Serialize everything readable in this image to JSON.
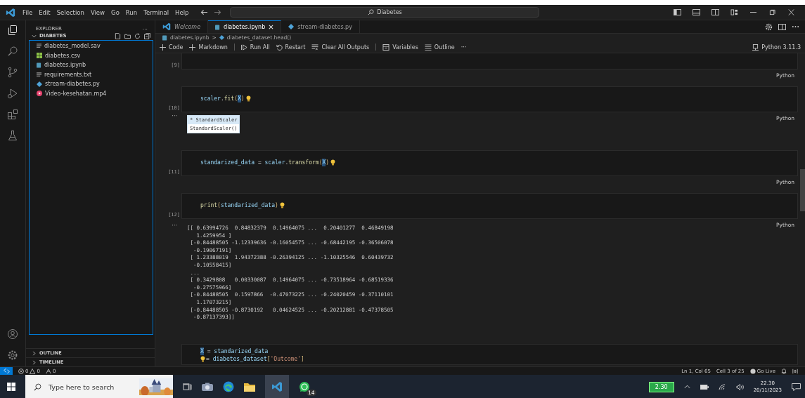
{
  "menu": [
    "File",
    "Edit",
    "Selection",
    "View",
    "Go",
    "Run",
    "Terminal",
    "Help"
  ],
  "command_center": {
    "value": "Diabetes"
  },
  "explorer": {
    "title": "EXPLORER",
    "more": "···",
    "folder": "DIABETES",
    "expanded": true,
    "files": [
      {
        "name": "diabetes_model.sav",
        "kind": "text"
      },
      {
        "name": "diabetes.csv",
        "kind": "csv"
      },
      {
        "name": "diabetes.ipynb",
        "kind": "notebook"
      },
      {
        "name": "requirements.txt",
        "kind": "text"
      },
      {
        "name": "stream-diabetes.py",
        "kind": "python"
      },
      {
        "name": "Video-kesehatan.mp4",
        "kind": "video"
      }
    ],
    "sections": [
      {
        "label": "OUTLINE",
        "expanded": false
      },
      {
        "label": "TIMELINE",
        "expanded": false
      }
    ]
  },
  "tabs": [
    {
      "label": "Welcome",
      "kind": "welcome",
      "selected": false
    },
    {
      "label": "diabetes.ipynb",
      "kind": "notebook",
      "selected": true
    },
    {
      "label": "stream-diabetes.py",
      "kind": "python",
      "selected": false
    }
  ],
  "breadcrumb": [
    "diabetes.ipynb",
    ">",
    "diabetes_dataset.head()"
  ],
  "toolbar": [
    {
      "label": "Code",
      "kind": "plus"
    },
    {
      "label": "Markdown",
      "kind": "plus"
    },
    {
      "label": "Run All",
      "kind": "run"
    },
    {
      "label": "Restart",
      "kind": "restart"
    },
    {
      "label": "Clear All Outputs",
      "kind": "clear"
    },
    {
      "label": "Variables",
      "kind": "variables"
    },
    {
      "label": "Outline",
      "kind": "outline"
    }
  ],
  "toolbar_more": "···",
  "kernel": "Python 3.11.3",
  "cells": [
    {
      "number": "[9]",
      "lang": "Python"
    },
    {
      "number": "[10]",
      "lang": "Python",
      "lines": [
        "scaler.fit(X)"
      ],
      "output": {
        "kind": "widget",
        "marker": "···",
        "title": "* StandardScaler",
        "body": "StandardScaler()"
      }
    },
    {
      "number": "[11]",
      "lang": "Python",
      "lines": [
        "standarized_data = scaler.transform(X)"
      ]
    },
    {
      "number": "[12]",
      "lang": "Python",
      "lines": [
        "print(standarized_data)"
      ],
      "output": {
        "kind": "text",
        "marker": "···",
        "lines": [
          "[[ 0.63994726  0.84832379  0.14964075 ...  0.20401277  0.46849198",
          "   1.4259954 ]",
          " [-0.84488505 -1.12339636 -0.16054575 ... -0.68442195 -0.36506078",
          "  -0.19067191]",
          " [ 1.23388019  1.94372388 -0.26394125 ... -1.10325546  0.60439732",
          "  -0.10558415]",
          " ...",
          " [ 0.3429808   0.00330087  0.14964075 ... -0.73518964 -0.68519336",
          "  -0.27575966]",
          " [-0.84488505  0.1597866  -0.47073225 ... -0.24020459 -0.37110101",
          "   1.17073215]",
          " [-0.84488505 -0.8730192   0.04624525 ... -0.20212881 -0.47378505",
          "  -0.87137393]]"
        ]
      }
    },
    {
      "lines": [
        "X = standarized_data",
        "= diabetes_dataset['Outcome']"
      ]
    }
  ],
  "status_bar": {
    "errors": "0",
    "warnings": "0",
    "ports": "0",
    "position": "Ln 1, Col 65",
    "cell": "Cell 3 of 25",
    "go_live": "Go Live"
  },
  "taskbar": {
    "search_placeholder": "Type here to search",
    "whatsapp_badge": "14",
    "battery": "2.30",
    "time": "22.30",
    "date": "20/11/2023"
  }
}
